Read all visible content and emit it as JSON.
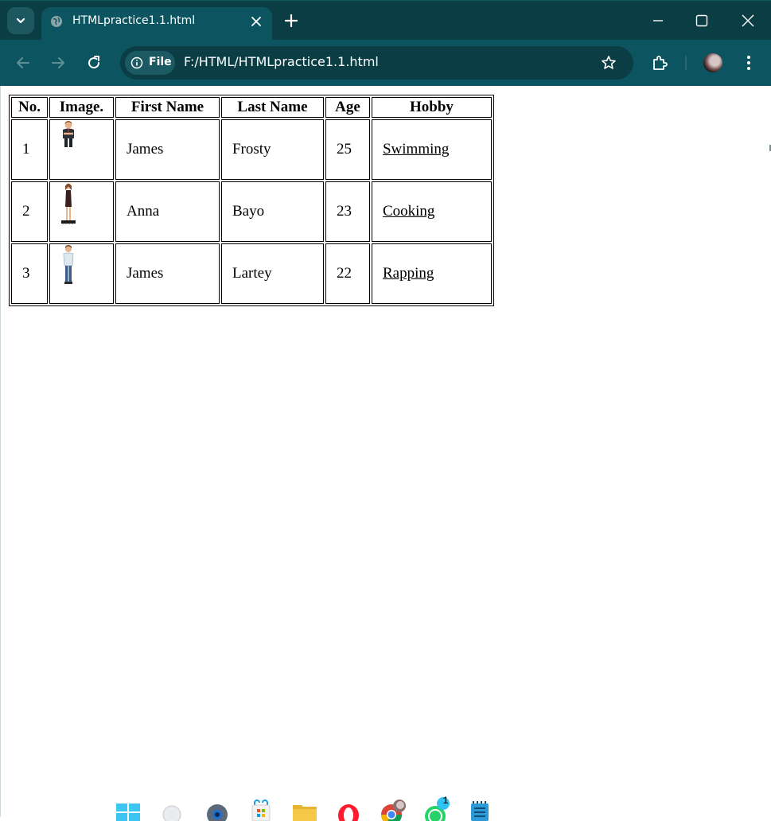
{
  "browser": {
    "tab_title": "HTMLpractice1.1.html",
    "chip_label": "File",
    "url": "F:/HTML/HTMLpractice1.1.html"
  },
  "table": {
    "headers": [
      "No.",
      "Image.",
      "First Name",
      "Last Name",
      "Age",
      "Hobby"
    ],
    "rows": [
      {
        "no": "1",
        "image_icon": "man-in-suit-avatar-icon",
        "first_name": "James",
        "last_name": "Frosty",
        "age": "25",
        "hobby": "Swimming"
      },
      {
        "no": "2",
        "image_icon": "woman-in-dress-avatar-icon",
        "first_name": "Anna",
        "last_name": "Bayo",
        "age": "23",
        "hobby": "Cooking"
      },
      {
        "no": "3",
        "image_icon": "man-casual-avatar-icon",
        "first_name": "James",
        "last_name": "Lartey",
        "age": "22",
        "hobby": "Rapping"
      }
    ]
  },
  "taskbar": {
    "items": [
      "windows-start-icon",
      "search-icon",
      "settings-icon",
      "microsoft-store-icon",
      "file-explorer-icon",
      "opera-icon",
      "chrome-icon",
      "whatsapp-icon",
      "notepad-icon"
    ],
    "whatsapp_badge": "1"
  },
  "colors": {
    "tabstrip": "#0a3d44",
    "toolbar": "#0c5560",
    "page_bg": "#ffffff"
  }
}
